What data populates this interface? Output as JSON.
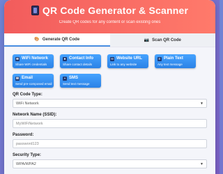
{
  "app": {
    "title": "QR Code Generator & Scanner",
    "subtitle": "Create QR codes for any content or scan existing ones",
    "title_icon": "mobile-phone-icon"
  },
  "tabs": [
    {
      "label": "Generate QR Code",
      "icon": "palette-icon",
      "active": true
    },
    {
      "label": "Scan QR Code",
      "icon": "camera-icon",
      "active": false
    }
  ],
  "types": [
    {
      "label": "WiFi Network",
      "desc": "Share WiFi credentials",
      "icon": "wifi-icon"
    },
    {
      "label": "Contact Info",
      "desc": "Share contact details",
      "icon": "contact-icon"
    },
    {
      "label": "Website URL",
      "desc": "Link to any website",
      "icon": "link-icon"
    },
    {
      "label": "Plain Text",
      "desc": "Any text message",
      "icon": "text-icon"
    },
    {
      "label": "Email",
      "desc": "Send pre-composed email",
      "icon": "email-icon"
    },
    {
      "label": "SMS",
      "desc": "Send text message",
      "icon": "sms-icon"
    }
  ],
  "form": {
    "qr_type": {
      "label": "QR Code Type:",
      "value": "WiFi Network"
    },
    "ssid": {
      "label": "Network Name (SSID):",
      "placeholder": "MyWiFiNetwork"
    },
    "password": {
      "label": "Password:",
      "placeholder": "password123"
    },
    "security": {
      "label": "Security Type:",
      "value": "WPA/WPA2"
    }
  },
  "colors": {
    "header_start": "#f25c5c",
    "header_end": "#ff7a6b",
    "button_blue": "#2b82e6",
    "background": "#7a5fc4"
  }
}
